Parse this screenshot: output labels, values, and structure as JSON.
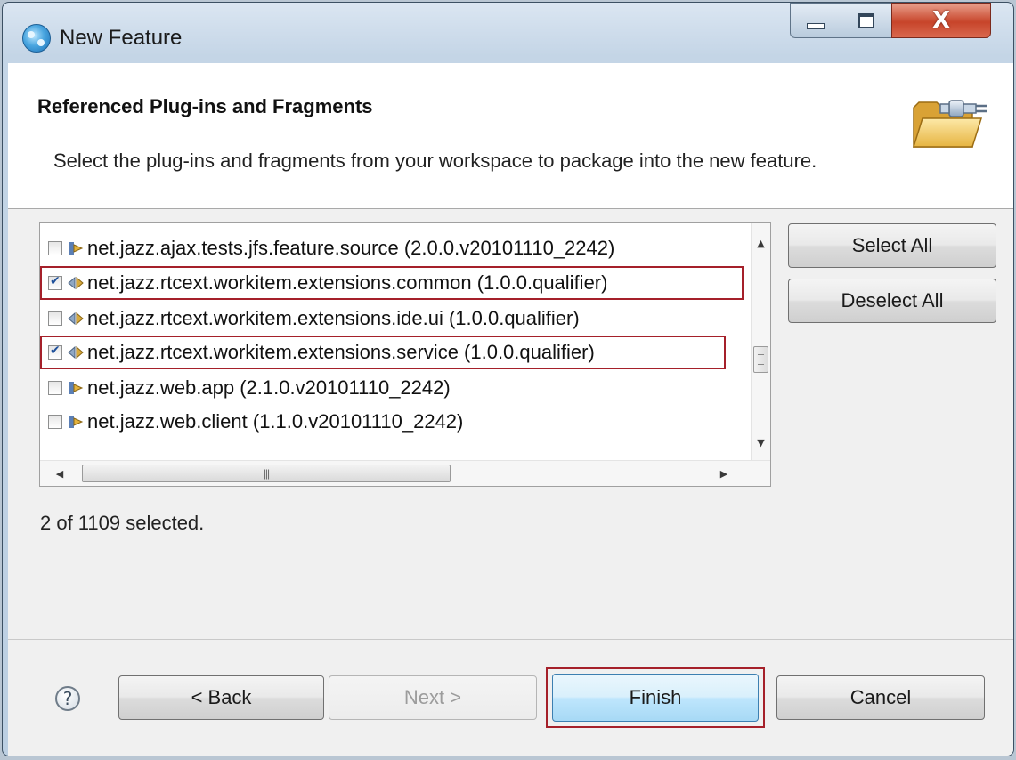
{
  "window": {
    "title": "New Feature",
    "close_glyph": "X",
    "minimize_icon": "minimize-icon",
    "maximize_icon": "maximize-icon"
  },
  "header": {
    "title": "Referenced Plug-ins and Fragments",
    "description": "Select the plug-ins and fragments from your workspace to package into the new feature.",
    "icon": "folder-plugin-icon"
  },
  "plugin_list": {
    "items": [
      {
        "label": "net.jazz.ajax.tests.jfs.feature.source (2.0.0.v20101110_2242)",
        "checked": false,
        "icon": "feature-plugin-icon",
        "highlighted": false
      },
      {
        "label": "net.jazz.rtcext.workitem.extensions.common (1.0.0.qualifier)",
        "checked": true,
        "icon": "workspace-plugin-icon",
        "highlighted": true
      },
      {
        "label": "net.jazz.rtcext.workitem.extensions.ide.ui (1.0.0.qualifier)",
        "checked": false,
        "icon": "workspace-plugin-icon",
        "highlighted": false
      },
      {
        "label": "net.jazz.rtcext.workitem.extensions.service (1.0.0.qualifier)",
        "checked": true,
        "icon": "workspace-plugin-icon",
        "highlighted": true
      },
      {
        "label": "net.jazz.web.app (2.1.0.v20101110_2242)",
        "checked": false,
        "icon": "feature-plugin-icon",
        "highlighted": false
      },
      {
        "label": "net.jazz.web.client (1.1.0.v20101110_2242)",
        "checked": false,
        "icon": "feature-plugin-icon",
        "highlighted": false
      }
    ],
    "vertical_scroll_position": 0.5,
    "horizontal_scroll_position": 0.0
  },
  "side_buttons": {
    "select_all": "Select All",
    "deselect_all": "Deselect All"
  },
  "status": "2 of 1109 selected.",
  "footer": {
    "help_glyph": "?",
    "back": "< Back",
    "next": "Next >",
    "finish": "Finish",
    "cancel": "Cancel"
  },
  "colors": {
    "highlight_outline": "#a5202a",
    "default_button": "#bee6fd",
    "close_button": "#c7442a"
  }
}
